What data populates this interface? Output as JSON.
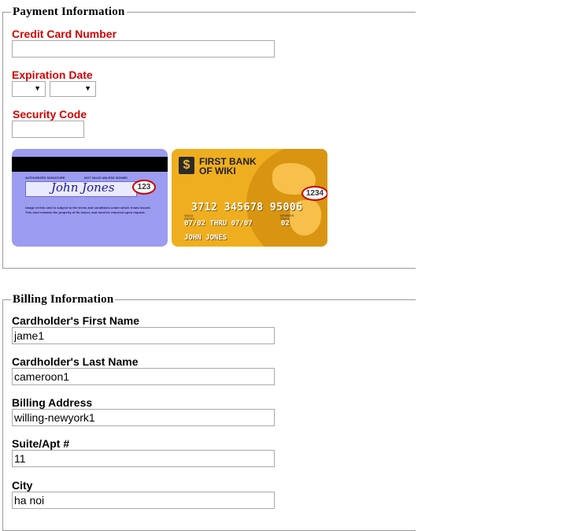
{
  "payment": {
    "legend": "Payment Information",
    "cc_label": "Credit Card Number",
    "cc_value": "",
    "exp_label": "Expiration Date",
    "exp_month": "",
    "exp_year": "",
    "sec_label": "Security Code",
    "sec_value": "",
    "card_back": {
      "auth_sig": "AUTHORIZED SIGNATURE",
      "not_valid": "NOT VALID UNLESS SIGNED",
      "signature": "John Jones",
      "cvv": "123",
      "fine_print_1": "Usage of this card is subject to the terms and conditions under which it was issued.",
      "fine_print_2": "This card remains the property of its issuer, and must be returned upon request."
    },
    "card_front": {
      "bank_line1": "FIRST BANK",
      "bank_line2": "OF WIKI",
      "logo_glyph": "$",
      "cvv": "1234",
      "number": "3712 345678 95006",
      "valid_label": "VALID DATES",
      "dates": "07/02 THRU 07/07",
      "member_label": "MEMBER SINCE",
      "member_since": "02",
      "holder": "JOHN JONES"
    }
  },
  "billing": {
    "legend": "Billing Information",
    "first_name_label": "Cardholder's First Name",
    "first_name_value": "jame1",
    "last_name_label": "Cardholder's Last Name",
    "last_name_value": "cameroon1",
    "address_label": "Billing Address",
    "address_value": "willing-newyork1",
    "suite_label": "Suite/Apt #",
    "suite_value": "11",
    "city_label": "City",
    "city_value": "ha noi"
  }
}
